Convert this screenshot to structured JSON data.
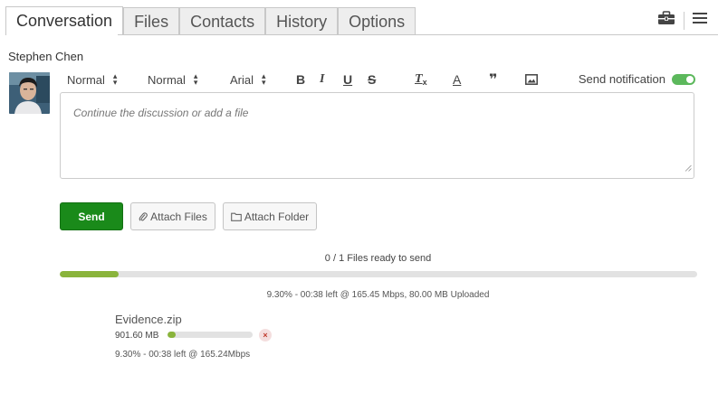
{
  "tabs": [
    {
      "label": "Conversation"
    },
    {
      "label": "Files"
    },
    {
      "label": "Contacts"
    },
    {
      "label": "History"
    },
    {
      "label": "Options"
    }
  ],
  "header_icons": [
    "toolbox-icon",
    "menu-icon"
  ],
  "user": {
    "name": "Stephen Chen"
  },
  "toolbar": {
    "paragraph_format": "Normal",
    "font_size": "Normal",
    "font_family": "Arial",
    "buttons": [
      "bold-icon",
      "italic-icon",
      "underline-icon",
      "strikethrough-icon",
      "clear-format-icon",
      "text-color-icon",
      "quote-icon",
      "image-icon"
    ],
    "bold_glyph": "B",
    "italic_glyph": "I",
    "underline_glyph": "U",
    "strike_glyph": "S",
    "clear_glyph": "T",
    "color_glyph": "A",
    "quote_glyph": "❞"
  },
  "notification": {
    "label": "Send notification",
    "enabled": true
  },
  "editor": {
    "placeholder": "Continue the discussion or add a file"
  },
  "actions": {
    "send_label": "Send",
    "attach_files_label": "Attach Files",
    "attach_folder_label": "Attach Folder"
  },
  "upload": {
    "ready_text": "0 / 1 Files ready to send",
    "progress_fraction": 0.093,
    "stats_text": "9.30% - 00:38 left @ 165.45 Mbps, 80.00 MB Uploaded"
  },
  "files": [
    {
      "name": "Evidence.zip",
      "size": "901.60 MB",
      "progress_fraction": 0.093,
      "stats_text": "9.30% - 00:38 left @ 165.24Mbps",
      "remove_glyph": "×"
    }
  ],
  "colors": {
    "accent_green": "#1a8a1a",
    "progress_green": "#8ab43c",
    "toggle_green": "#5cb85c",
    "remove_red": "#c0392b"
  }
}
